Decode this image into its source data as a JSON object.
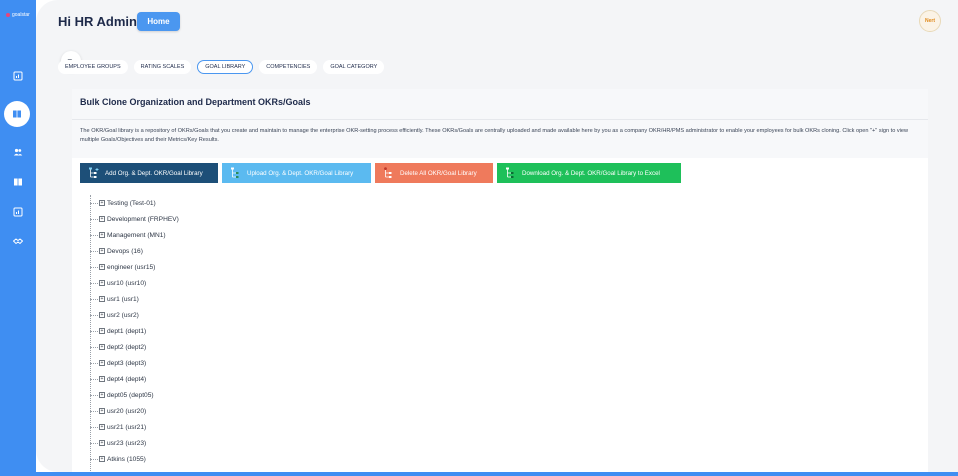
{
  "brand": {
    "logo_text": "goalstar"
  },
  "header": {
    "greeting": "Hi HR Admin",
    "home_label": "Home",
    "avatar_text": "Nert"
  },
  "sidebar": {
    "items": [
      {
        "icon": "chart-icon"
      },
      {
        "icon": "book-icon",
        "active": true
      },
      {
        "icon": "people-icon"
      },
      {
        "icon": "book-icon"
      },
      {
        "icon": "chart-icon"
      },
      {
        "icon": "handshake-icon"
      }
    ],
    "collapse_icon": "collapse-arrow-icon"
  },
  "tabs": [
    {
      "label": "EMPLOYEE GROUPS",
      "active": false
    },
    {
      "label": "RATING SCALES",
      "active": false
    },
    {
      "label": "GOAL LIBRARY",
      "active": true
    },
    {
      "label": "COMPETENCIES",
      "active": false
    },
    {
      "label": "GOAL CATEGORY",
      "active": false
    }
  ],
  "card": {
    "title": "Bulk Clone Organization and Department OKRs/Goals",
    "description": "The OKR/Goal library is a repository of OKRs/Goals that you create and maintain to manage the enterprise OKR-setting process efficiently. These OKRs/Goals are centrally uploaded and made available here by you as a company OKR/HR/PMS administrator to enable your employees for bulk OKRs cloning. Click open \"+\" sign to view multiple Goals/Objectives and their Metrics/Key Results."
  },
  "actions": {
    "add": "Add Org. & Dept. OKR/Goal Library",
    "upload": "Upload Org. & Dept. OKR/Goal Library",
    "delete": "Delete All OKR/Goal Library",
    "download": "Download Org. & Dept. OKR/Goal Library to Excel"
  },
  "tree": [
    "Testing (Test-01)",
    "Development (FRPHEV)",
    "Management (MN1)",
    "Devops (16)",
    "engineer (usr15)",
    "usr10 (usr10)",
    "usr1 (usr1)",
    "usr2 (usr2)",
    "dept1 (dept1)",
    "dept2 (dept2)",
    "dept3 (dept3)",
    "dept4 (dept4)",
    "dept05 (dept05)",
    "usr20 (usr20)",
    "usr21 (usr21)",
    "usr23 (usr23)",
    "Atkins (1055)"
  ],
  "colors": {
    "sidebar": "#3f8ef2",
    "home": "#4b97f0",
    "add": "#1d4f78",
    "upload": "#5bbaf0",
    "delete": "#ef7a5c",
    "download": "#1ec05a"
  }
}
